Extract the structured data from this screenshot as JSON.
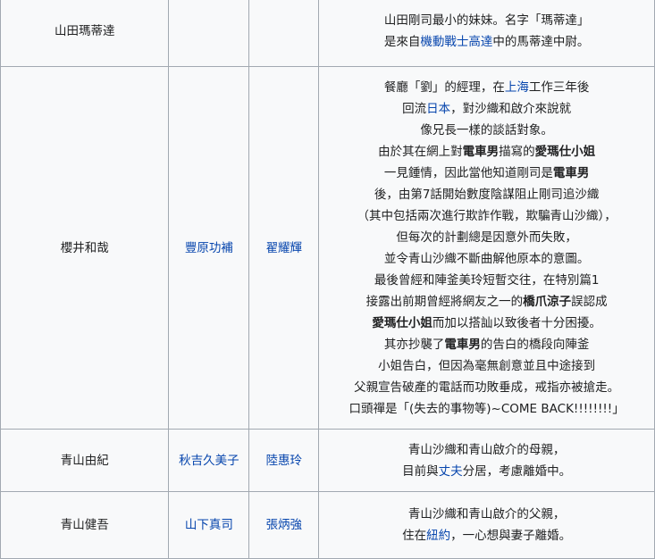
{
  "rows": [
    {
      "name": "山田瑪蒂達",
      "ja_voice": "",
      "hk_voice": "",
      "desc_lines": [
        [
          {
            "t": "山田剛司最小的妹妹。名字「瑪蒂達」"
          }
        ],
        [
          {
            "t": "是來自"
          },
          {
            "t": "機動戰士高達",
            "link": true
          },
          {
            "t": "中的馬蒂達中尉。"
          }
        ]
      ]
    },
    {
      "name": "櫻井和哉",
      "ja_voice": "豐原功補",
      "hk_voice": "翟耀輝",
      "desc_lines": [
        [
          {
            "t": "餐廳「劉」的經理，在"
          },
          {
            "t": "上海",
            "link": true
          },
          {
            "t": "工作三年後"
          }
        ],
        [
          {
            "t": "回流"
          },
          {
            "t": "日本",
            "link": true
          },
          {
            "t": "，對沙織和啟介來說就"
          }
        ],
        [
          {
            "t": "像兄長一樣的談話對象。"
          }
        ],
        [
          {
            "t": "由於其在網上對"
          },
          {
            "t": "電車男",
            "bold": true
          },
          {
            "t": "描寫的"
          },
          {
            "t": "愛瑪仕小姐",
            "bold": true
          }
        ],
        [
          {
            "t": "一見鍾情，因此當他知道剛司是"
          },
          {
            "t": "電車男",
            "bold": true
          }
        ],
        [
          {
            "t": "後，由第7話開始數度陰謀阻止剛司追沙織"
          }
        ],
        [
          {
            "t": "（其中包括兩次進行欺詐作戰，欺騙青山沙織），"
          }
        ],
        [
          {
            "t": "但每次的計劃總是因意外而失敗，"
          }
        ],
        [
          {
            "t": "並令青山沙織不斷曲解他原本的意圖。"
          }
        ],
        [
          {
            "t": "最後曾經和陣釜美玲短暫交往，在特別篇1"
          }
        ],
        [
          {
            "t": "接露出前期曾經將網友之一的"
          },
          {
            "t": "橋爪涼子",
            "bold": true
          },
          {
            "t": "誤認成"
          }
        ],
        [
          {
            "t": "愛瑪仕小姐",
            "bold": true
          },
          {
            "t": "而加以搭訕以致後者十分困擾。"
          }
        ],
        [
          {
            "t": "其亦抄襲了"
          },
          {
            "t": "電車男",
            "bold": true
          },
          {
            "t": "的告白的橋段向陣釜"
          }
        ],
        [
          {
            "t": "小姐告白，但因為毫無創意並且中途接到"
          }
        ],
        [
          {
            "t": "父親宣告破產的電話而功敗垂成，戒指亦被搶走。"
          }
        ],
        [
          {
            "t": "口頭禪是「(失去的事物等)~COME BACK!!!!!!!!」"
          }
        ]
      ]
    },
    {
      "name": "青山由紀",
      "ja_voice": "秋吉久美子",
      "hk_voice": "陸惠玲",
      "desc_lines": [
        [
          {
            "t": "青山沙織和青山啟介的母親，"
          }
        ],
        [
          {
            "t": "目前與"
          },
          {
            "t": "丈夫",
            "link": true
          },
          {
            "t": "分居，考慮離婚中。"
          }
        ]
      ]
    },
    {
      "name": "青山健吾",
      "ja_voice": "山下真司",
      "hk_voice": "張炳強",
      "desc_lines": [
        [
          {
            "t": "青山沙織和青山啟介的父親，"
          }
        ],
        [
          {
            "t": "住在"
          },
          {
            "t": "紐約",
            "link": true
          },
          {
            "t": "，一心想與妻子離婚。"
          }
        ]
      ]
    }
  ]
}
